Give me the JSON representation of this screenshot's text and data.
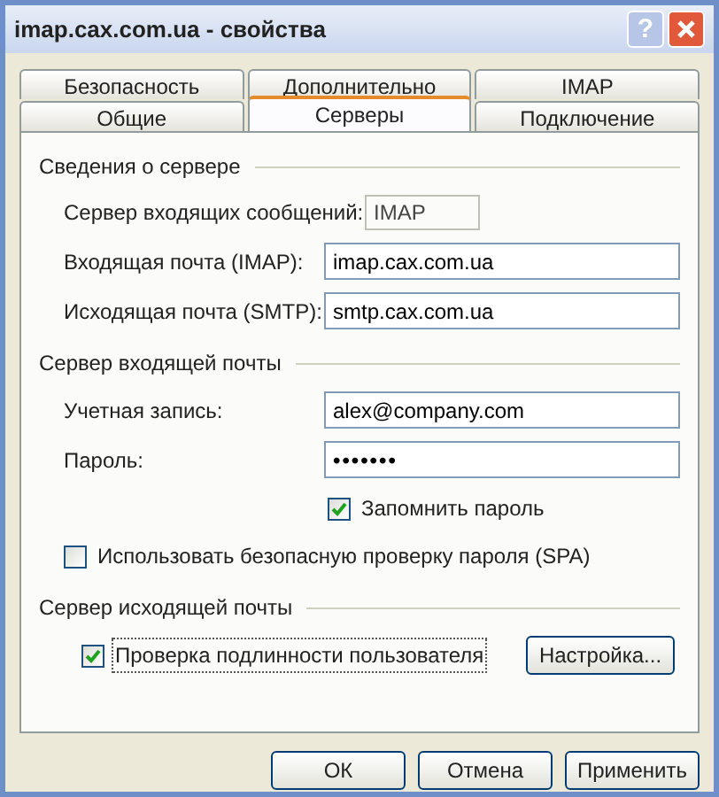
{
  "window": {
    "title": "imap.cax.com.ua - свойства",
    "help": "?"
  },
  "tabs": [
    [
      {
        "label": "Безопасность",
        "selected": false
      },
      {
        "label": "Дополнительно",
        "selected": false
      },
      {
        "label": "IMAP",
        "selected": false
      }
    ],
    [
      {
        "label": "Общие",
        "selected": false
      },
      {
        "label": "Серверы",
        "selected": true
      },
      {
        "label": "Подключение",
        "selected": false
      }
    ]
  ],
  "server_info": {
    "title": "Сведения о сервере",
    "type_label": "Сервер входящих сообщений:",
    "type_value": "IMAP",
    "fields": [
      {
        "label": "Входящая почта (IMAP):",
        "value": "imap.cax.com.ua"
      },
      {
        "label": "Исходящая почта (SMTP):",
        "value": "smtp.cax.com.ua"
      }
    ]
  },
  "incoming": {
    "title": "Сервер входящей почты",
    "fields": [
      {
        "label": "Учетная запись:",
        "value": "alex@company.com",
        "kind": "text"
      },
      {
        "label": "Пароль:",
        "value": "•••••••",
        "kind": "password"
      }
    ],
    "remember": {
      "label": "Запомнить пароль",
      "checked": true
    },
    "spa": {
      "label": "Использовать безопасную проверку пароля (SPA)",
      "checked": false
    }
  },
  "outgoing": {
    "title": "Сервер исходящей почты",
    "auth": {
      "label": "Проверка подлинности пользователя",
      "checked": true,
      "focused": true
    },
    "settings_button": "Настройка..."
  },
  "buttons": [
    "ОК",
    "Отмена",
    "Применить"
  ]
}
